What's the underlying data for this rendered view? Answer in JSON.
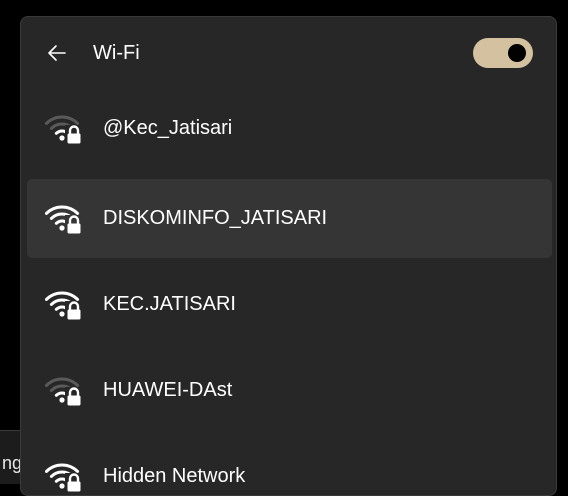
{
  "background_window": {
    "partial_text": "ng"
  },
  "header": {
    "title": "Wi-Fi",
    "back_icon": "arrow-left-icon",
    "wifi_toggle": {
      "state": "on",
      "accent_color": "#d4c1a0"
    }
  },
  "networks": [
    {
      "name": "@Kec_Jatisari",
      "signal_bars": 2,
      "secured": true,
      "selected": false
    },
    {
      "name": "DISKOMINFO_JATISARI",
      "signal_bars": 4,
      "secured": true,
      "selected": true
    },
    {
      "name": "KEC.JATISARI",
      "signal_bars": 4,
      "secured": true,
      "selected": false
    },
    {
      "name": "HUAWEI-DAst",
      "signal_bars": 2,
      "secured": true,
      "selected": false
    },
    {
      "name": "Hidden Network",
      "signal_bars": 4,
      "secured": true,
      "selected": false
    }
  ],
  "colors": {
    "panel_bg": "#272727",
    "selected_bg": "#353535",
    "text": "#ffffff",
    "signal_active": "#ffffff",
    "signal_inactive": "#5a5a5a"
  }
}
